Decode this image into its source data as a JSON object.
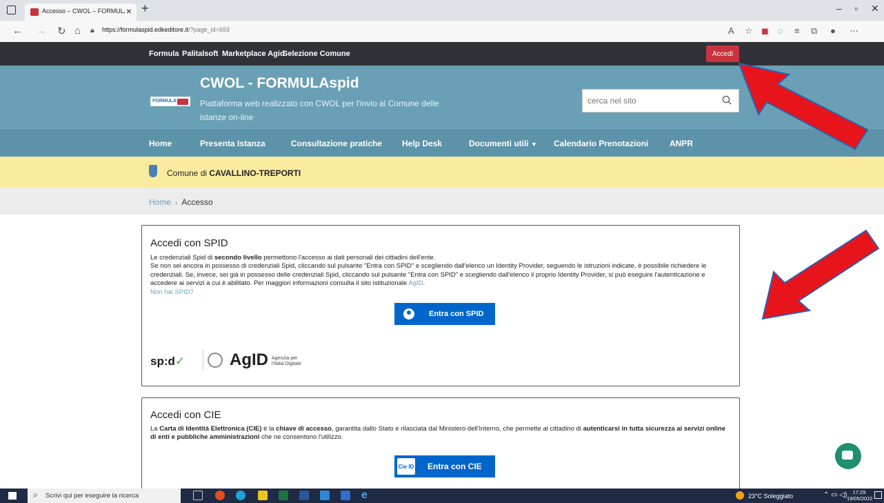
{
  "browser": {
    "tab_title": "Accesso – CWOL – FORMULAspi",
    "url_host": "https://formulaspid.edkeditore.it",
    "url_path": "/?page_id=693"
  },
  "topnav": {
    "links": [
      "Formula",
      "Palitalsoft",
      "Marketplace Agid",
      "Selezione Comune"
    ],
    "login_label": "Accedi"
  },
  "header": {
    "logo_text": "FORMULA",
    "title": "CWOL - FORMULAspid",
    "subtitle": "Piattaforma web realizzato con CWOL per l'invio al Comune delle istanze on-line",
    "search_placeholder": "cerca nel sito"
  },
  "mainnav": {
    "items": [
      "Home",
      "Presenta Istanza",
      "Consultazione pratiche",
      "Help Desk",
      "Documenti utili",
      "Calendario Prenotazioni",
      "ANPR"
    ]
  },
  "comune": {
    "prefix": "Comune di",
    "name": "CAVALLINO-TREPORTI"
  },
  "breadcrumb": {
    "home": "Home",
    "sep": "›",
    "current": "Accesso"
  },
  "spid_card": {
    "title": "Accedi con SPID",
    "p1_a": "Le credenziali Spid di ",
    "p1_bold": "secondo livello",
    "p1_b": " permettono l'accesso ai dati personali dei cittadini dell'ente.",
    "p2": "Se non sei ancora in possesso di credenziali Spid, cliccando sul pulsante \"Entra con SPID\" e scegliendo dall'elenco un Identity Provider, seguendo le istruzioni indicate, è possibile richiedere le credenziali. Se, invece, sei già in possesso delle credenziali Spid, cliccando sul pulsante \"Entra con SPID\" e scegliendo dall'elenco il proprio Identity Provider, si può eseguire l'autenticazione e accedere ai servizi a cui è abilitato. Per maggiori informazioni consulta il sito istituzionale ",
    "agid_link": "AgID",
    "p2_end": ".",
    "no_spid_link": "Non hai SPID?",
    "button_label": "Entra con SPID",
    "spid_logo": "sp:d",
    "agid_logo": "AgID",
    "agid_sub_1": "Agenzia per",
    "agid_sub_2": "l'Italia Digitale"
  },
  "cie_card": {
    "title": "Accedi con CIE",
    "t1": "La ",
    "t2_bold": "Carta di Identità Elettronica (CIE)",
    "t3": " è la ",
    "t4_bold": "chiave di accesso",
    "t5": ", garantita dallo Stato e rilasciata dal Ministero dell'Interno, che permette al cittadino di ",
    "t6_bold": "autenticarsi in tutta sicurezza ai servizi online di enti e pubbliche amministrazioni",
    "t7": " che ne consentono l'utilizzo.",
    "button_icon_text": "Cie ID",
    "button_label": "Entra con CIE"
  },
  "taskbar": {
    "search_text": "Scrivi qui per eseguire la ricerca",
    "weather": "23°C Soleggiato",
    "time": "17:29",
    "date": "19/05/2022"
  },
  "colors": {
    "accent_red": "#c8333e",
    "header_teal": "#6aa0b5",
    "button_blue": "#0066cc",
    "comune_yellow": "#faeb9f"
  }
}
